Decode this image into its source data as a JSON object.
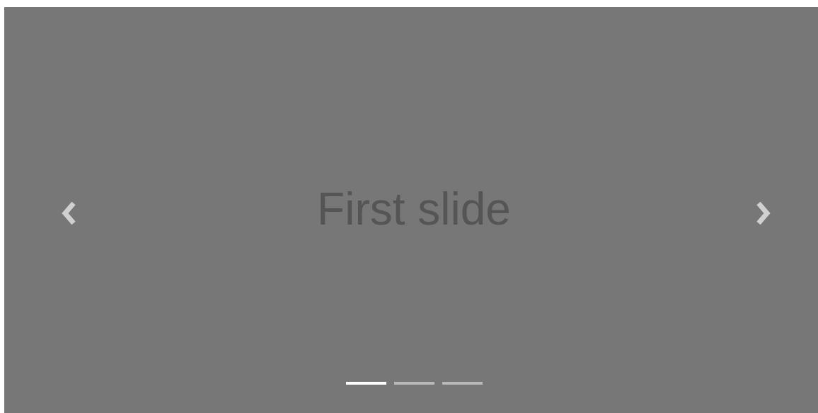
{
  "carousel": {
    "slide": {
      "text": "First slide"
    },
    "indicators": [
      {
        "selected": true
      },
      {
        "selected": false
      },
      {
        "selected": false
      }
    ]
  }
}
